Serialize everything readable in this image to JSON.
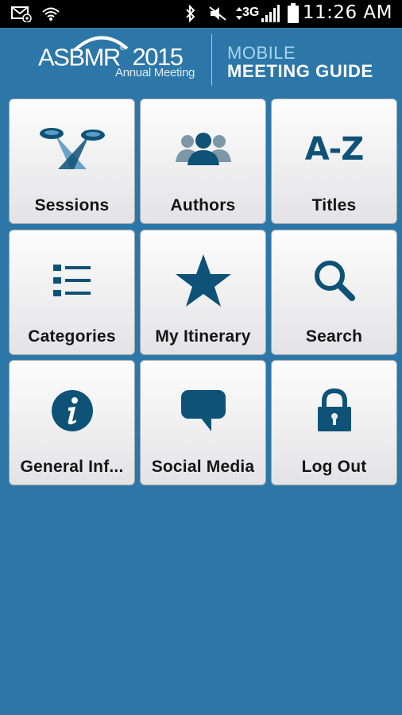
{
  "status_bar": {
    "time": "11:26 AM",
    "network": "3G"
  },
  "header": {
    "logo_name": "ASBMR",
    "logo_year": "2015",
    "logo_subtitle": "Annual Meeting",
    "title_line1": "MOBILE",
    "title_line2": "MEETING GUIDE"
  },
  "tiles": [
    {
      "label": "Sessions",
      "icon": "spotlights-icon"
    },
    {
      "label": "Authors",
      "icon": "people-icon"
    },
    {
      "label": "Titles",
      "icon": "a-z-icon",
      "icon_text": "A-Z"
    },
    {
      "label": "Categories",
      "icon": "list-icon"
    },
    {
      "label": "My Itinerary",
      "icon": "star-icon"
    },
    {
      "label": "Search",
      "icon": "magnifier-icon"
    },
    {
      "label": "General Inf...",
      "icon": "info-icon"
    },
    {
      "label": "Social Media",
      "icon": "speech-bubble-icon"
    },
    {
      "label": "Log Out",
      "icon": "padlock-icon"
    }
  ],
  "colors": {
    "background": "#2d77a8",
    "icon": "#0f5277",
    "tile_top": "#fdfdfd",
    "tile_bottom": "#e3e3e5"
  }
}
